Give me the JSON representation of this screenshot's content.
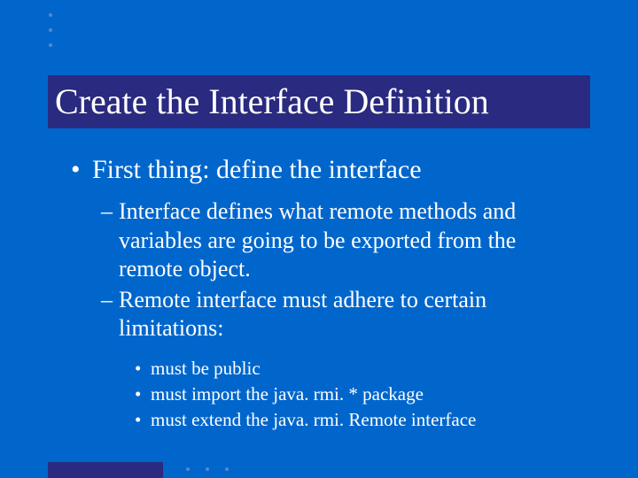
{
  "title": "Create the Interface Definition",
  "bullets": {
    "level1": "First thing: define the interface",
    "level2": [
      "Interface defines what remote methods and variables are going to be exported from the remote object.",
      "Remote interface must adhere to certain limitations:"
    ],
    "level3": [
      "must be public",
      "must import the java. rmi. * package",
      "must extend the java. rmi. Remote interface"
    ]
  }
}
